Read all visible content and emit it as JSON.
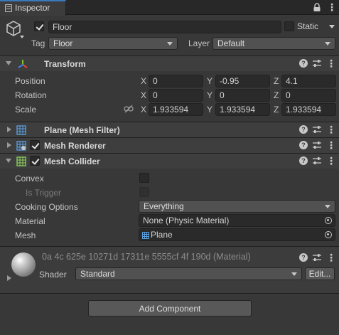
{
  "tab": {
    "label": "Inspector"
  },
  "gameobject": {
    "active": true,
    "name": "Floor",
    "static_label": "Static",
    "tag_label": "Tag",
    "tag_value": "Floor",
    "layer_label": "Layer",
    "layer_value": "Default"
  },
  "transform": {
    "title": "Transform",
    "position": {
      "label": "Position",
      "x": "0",
      "y": "-0.95",
      "z": "4.1"
    },
    "rotation": {
      "label": "Rotation",
      "x": "0",
      "y": "0",
      "z": "0"
    },
    "scale": {
      "label": "Scale",
      "x": "1.933594",
      "y": "1.933594",
      "z": "1.933594"
    },
    "axes": {
      "x": "X",
      "y": "Y",
      "z": "Z"
    }
  },
  "mesh_filter": {
    "title": "Plane (Mesh Filter)"
  },
  "mesh_renderer": {
    "title": "Mesh Renderer",
    "enabled": true
  },
  "mesh_collider": {
    "title": "Mesh Collider",
    "enabled": true,
    "convex_label": "Convex",
    "is_trigger_label": "Is Trigger",
    "cooking_label": "Cooking Options",
    "cooking_value": "Everything",
    "material_label": "Material",
    "material_value": "None (Physic Material)",
    "mesh_label": "Mesh",
    "mesh_value": "Plane"
  },
  "material": {
    "name": "0a 4c 625e 10271d 17311e 5555cf 4f 190d (Material)",
    "shader_label": "Shader",
    "shader_value": "Standard",
    "edit_label": "Edit..."
  },
  "add_component": {
    "label": "Add Component"
  },
  "colors": {
    "background": "#383838",
    "header": "#3e3e3e",
    "field": "#2a2a2a",
    "transform_x": "#e0453b",
    "transform_y": "#7cc42c",
    "transform_z": "#3f7fe8"
  }
}
